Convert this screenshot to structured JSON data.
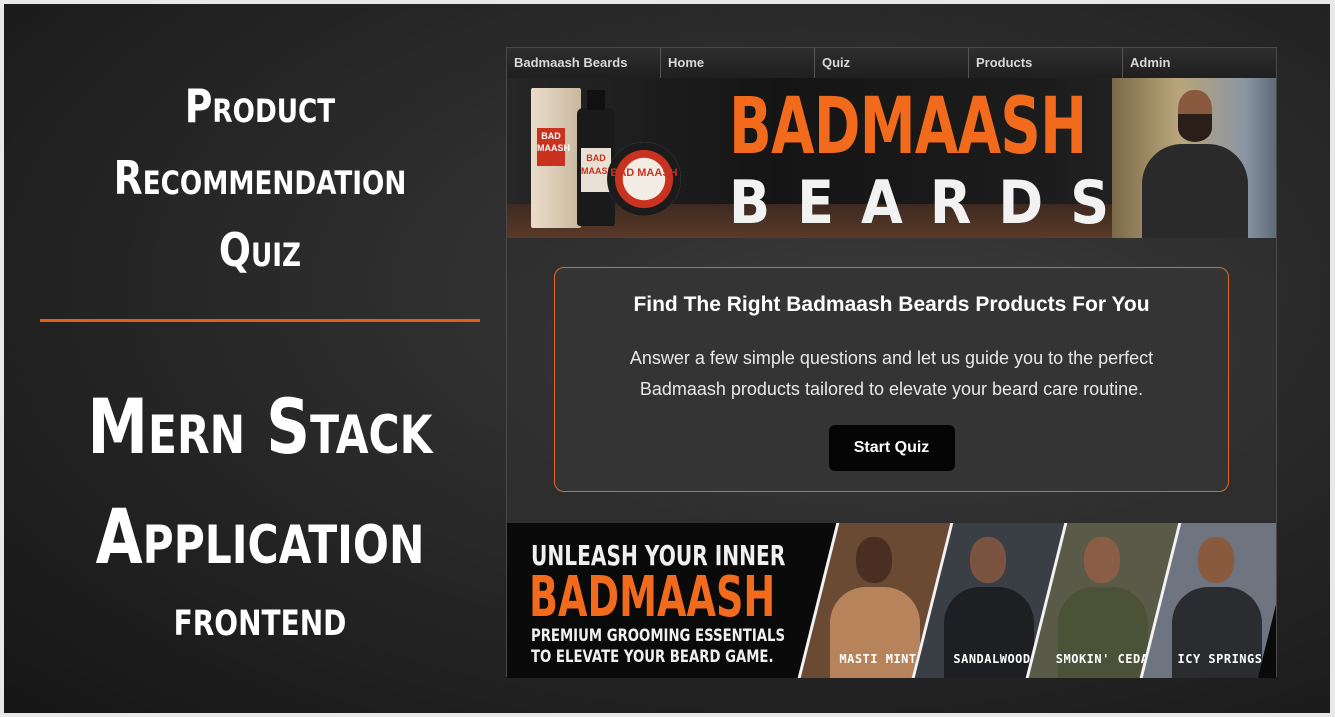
{
  "left_panel": {
    "title_line1": "Product",
    "title_line2": "Recommendation",
    "title_line3": "Quiz",
    "subtitle_line1": "Mern Stack",
    "subtitle_line2": "Application",
    "subtitle_line3": "frontend"
  },
  "nav": {
    "items": [
      {
        "label": "Badmaash Beards"
      },
      {
        "label": "Home"
      },
      {
        "label": "Quiz"
      },
      {
        "label": "Products"
      },
      {
        "label": "Admin"
      }
    ]
  },
  "hero": {
    "brand_top": "BADMAASH",
    "brand_bottom": "BEARDS",
    "box_label": "BAD MAASH",
    "bottle_label": "BAD MAASH",
    "tin_label": "BAD MAASH"
  },
  "quiz_card": {
    "heading": "Find The Right Badmaash Beards Products For You",
    "description": "Answer a few simple questions and let us guide you to the perfect Badmaash products tailored to elevate your beard care routine.",
    "button_label": "Start Quiz"
  },
  "promo": {
    "line1": "UNLEASH YOUR INNER",
    "line2": "BADMAASH",
    "line3a": "PREMIUM GROOMING ESSENTIALS",
    "line3b": "TO ELEVATE YOUR BEARD GAME.",
    "panels": [
      {
        "caption": "MASTI MINT"
      },
      {
        "caption": "SANDALWOOD"
      },
      {
        "caption": "SMOKIN' CEDAR"
      },
      {
        "caption": "ICY SPRINGS"
      }
    ]
  },
  "colors": {
    "accent": "#f26a1b",
    "divider": "#e0601a",
    "card_border": "#e0681e",
    "button_bg": "#050505"
  }
}
